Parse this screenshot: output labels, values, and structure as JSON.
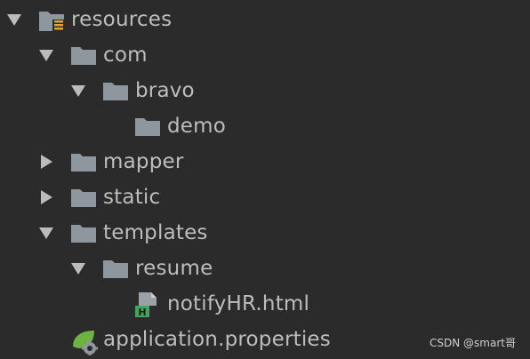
{
  "tree": {
    "items": [
      {
        "label": "resources",
        "expanded": true,
        "icon": "resources-folder-icon"
      },
      {
        "label": "com",
        "expanded": true,
        "icon": "folder-icon"
      },
      {
        "label": "bravo",
        "expanded": true,
        "icon": "folder-icon"
      },
      {
        "label": "demo",
        "icon": "folder-icon"
      },
      {
        "label": "mapper",
        "expanded": false,
        "icon": "folder-icon"
      },
      {
        "label": "static",
        "expanded": false,
        "icon": "folder-icon"
      },
      {
        "label": "templates",
        "expanded": true,
        "icon": "folder-icon"
      },
      {
        "label": "resume",
        "expanded": true,
        "icon": "folder-icon"
      },
      {
        "label": "notifyHR.html",
        "icon": "html-file-icon"
      },
      {
        "label": "application.properties",
        "icon": "spring-properties-icon"
      }
    ]
  },
  "colors": {
    "background": "#2b2b2b",
    "text": "#bdbdbd",
    "folder": "#8e979d",
    "html_badge": "#46a35e",
    "spring_leaf": "#6db33f"
  },
  "watermark": "CSDN @smart哥"
}
